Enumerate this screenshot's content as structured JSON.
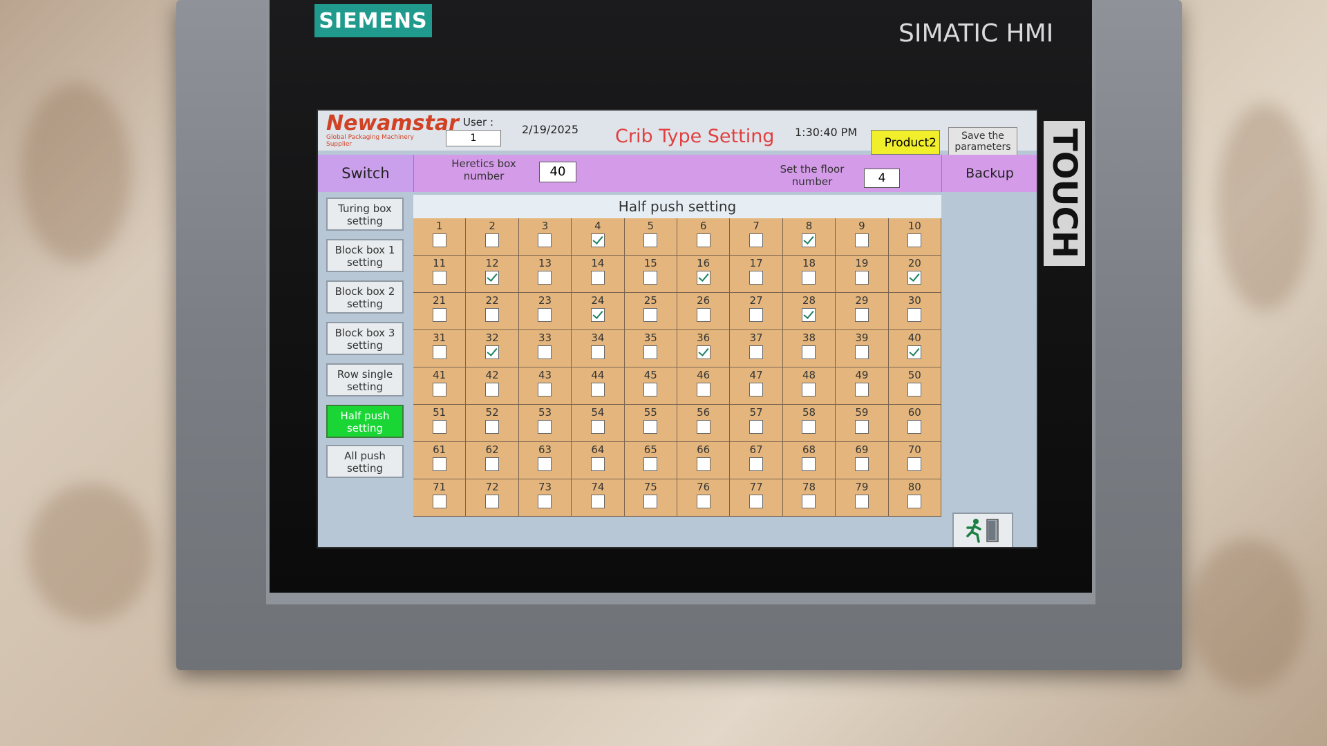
{
  "device": {
    "brand": "SIEMENS",
    "model": "SIMATIC HMI",
    "touch_label": "TOUCH"
  },
  "header": {
    "logo_main": "Newamstar",
    "logo_sub": "Global Packaging Machinery Supplier",
    "user_label": "User :",
    "user_value": "1",
    "date": "2/19/2025",
    "title": "Crib Type Setting",
    "time": "1:30:40 PM",
    "product_label": "Product2",
    "save_label": "Save the parameters"
  },
  "toolbar": {
    "switch_label": "Switch",
    "heretics_label": "Heretics box number",
    "heretics_value": "40",
    "floor_label": "Set the floor number",
    "floor_value": "4",
    "backup_label": "Backup"
  },
  "sidebar": {
    "items": [
      {
        "label": "Turing box setting",
        "active": false
      },
      {
        "label": "Block box 1 setting",
        "active": false
      },
      {
        "label": "Block box 2 setting",
        "active": false
      },
      {
        "label": "Block box 3 setting",
        "active": false
      },
      {
        "label": "Row single setting",
        "active": false
      },
      {
        "label": "Half push setting",
        "active": true
      },
      {
        "label": "All push setting",
        "active": false
      }
    ]
  },
  "panel": {
    "title": "Half push setting",
    "checked": [
      4,
      8,
      12,
      16,
      20,
      24,
      28,
      32,
      36,
      40
    ],
    "total": 80
  },
  "colors": {
    "brand": "#1f9a8d",
    "title_red": "#e23f3f",
    "active_green": "#19d635",
    "product_yellow": "#f1ee2b",
    "grid_bg": "#e4b67d",
    "purple_bar": "#d49be8"
  },
  "icons": {
    "exit": "running-man-exit-icon"
  }
}
